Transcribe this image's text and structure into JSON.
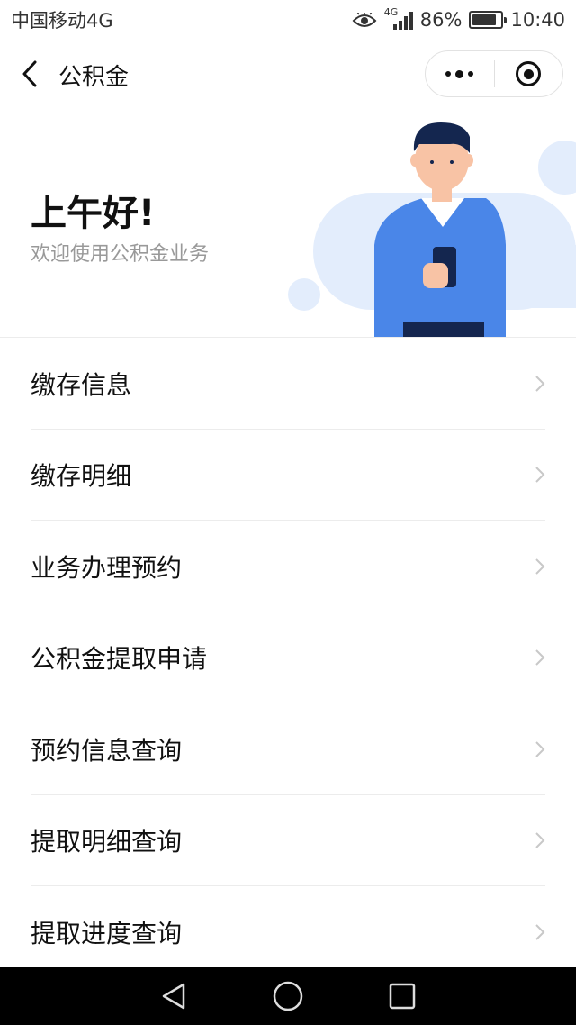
{
  "status_bar": {
    "carrier": "中国移动4G",
    "net_type": "4G",
    "battery": "86%",
    "battery_level": 0.86,
    "time": "10:40"
  },
  "nav": {
    "title": "公积金",
    "back_icon": "chevron-left-icon",
    "more_icon": "more-dots-icon",
    "close_icon": "target-icon"
  },
  "hero": {
    "greeting": "上午好!",
    "welcome": "欢迎使用公积金业务"
  },
  "menu": {
    "items": [
      {
        "label": "缴存信息"
      },
      {
        "label": "缴存明细"
      },
      {
        "label": "业务办理预约"
      },
      {
        "label": "公积金提取申请"
      },
      {
        "label": "预约信息查询"
      },
      {
        "label": "提取明细查询"
      },
      {
        "label": "提取进度查询"
      }
    ]
  },
  "colors": {
    "accent_blue": "#4a86e8",
    "light_blue": "#e3edfc",
    "dark_navy": "#14264f",
    "skin": "#f8c3a5"
  }
}
